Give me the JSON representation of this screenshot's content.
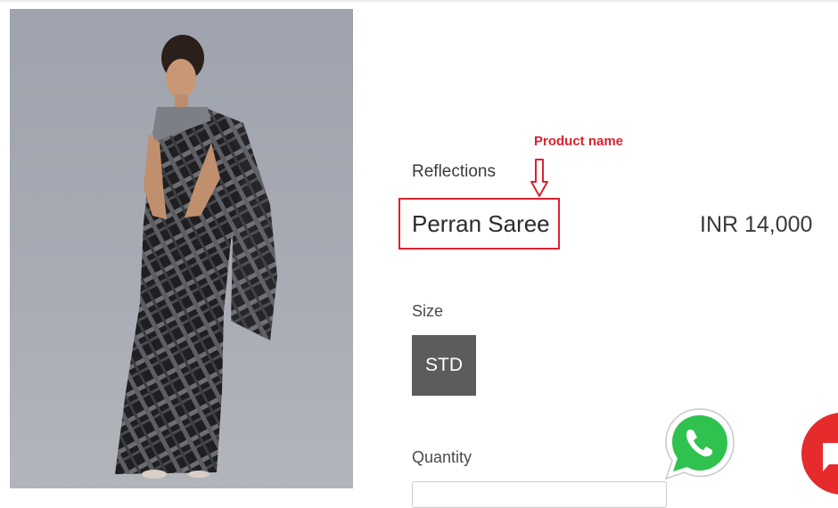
{
  "product": {
    "brand": "Reflections",
    "name": "Perran Saree",
    "price": "INR 14,000"
  },
  "annotation": {
    "label": "Product name",
    "color": "#d9232e"
  },
  "size": {
    "label": "Size",
    "options": [
      "STD"
    ],
    "selected": "STD"
  },
  "quantity": {
    "label": "Quantity",
    "value": ""
  },
  "floating_buttons": {
    "whatsapp_icon": "whatsapp-icon",
    "chat_icon": "chat-icon"
  },
  "colors": {
    "whatsapp_green": "#2fc24f",
    "chat_red": "#e52b2b",
    "size_selected_bg": "#5c5c5c"
  }
}
